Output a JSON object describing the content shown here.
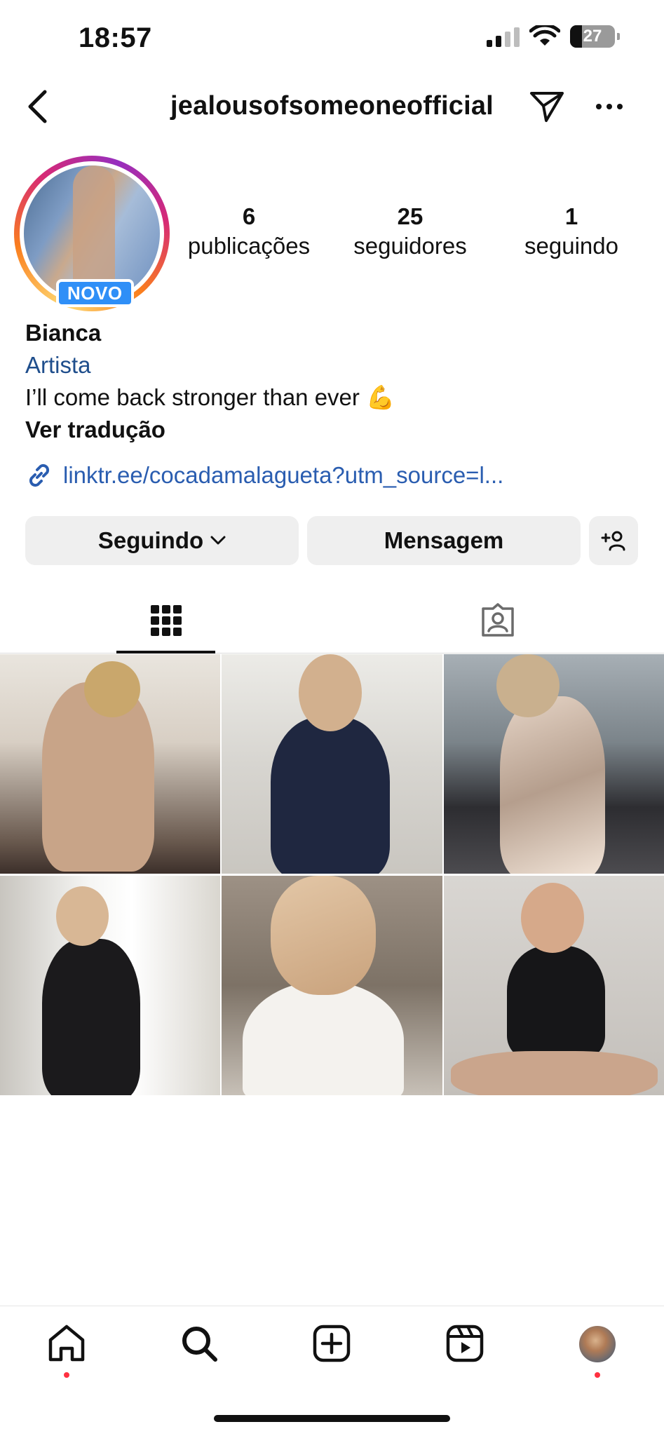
{
  "status_bar": {
    "time": "18:57",
    "battery_text": "27",
    "battery_level": 0.27
  },
  "header": {
    "username": "jealousofsomeoneofficial"
  },
  "profile": {
    "new_badge": "NOVO",
    "stats": [
      {
        "value": "6",
        "label": "publicações"
      },
      {
        "value": "25",
        "label": "seguidores"
      },
      {
        "value": "1",
        "label": "seguindo"
      }
    ],
    "name": "Bianca",
    "category": "Artista",
    "bio": "I’ll come back stronger than ever 💪",
    "translate_label": "Ver tradução",
    "link": "linktr.ee/cocadamalagueta?utm_source=l..."
  },
  "actions": {
    "following_label": "Seguindo",
    "message_label": "Mensagem"
  },
  "tabs": [
    {
      "icon": "grid-icon",
      "active": true
    },
    {
      "icon": "tagged-icon",
      "active": false
    }
  ],
  "posts": [
    {
      "id": "post-1"
    },
    {
      "id": "post-2"
    },
    {
      "id": "post-3"
    },
    {
      "id": "post-4"
    },
    {
      "id": "post-5"
    },
    {
      "id": "post-6"
    }
  ],
  "bottom_nav": [
    {
      "icon": "home-icon",
      "dot": true
    },
    {
      "icon": "search-icon",
      "dot": false
    },
    {
      "icon": "new-post-icon",
      "dot": false
    },
    {
      "icon": "reels-icon",
      "dot": false
    },
    {
      "icon": "profile-avatar",
      "dot": true
    }
  ],
  "colors": {
    "link": "#2a5db0",
    "category": "#1f4e8c",
    "badge": "#2f8ff7",
    "notification_dot": "#ff3040"
  }
}
